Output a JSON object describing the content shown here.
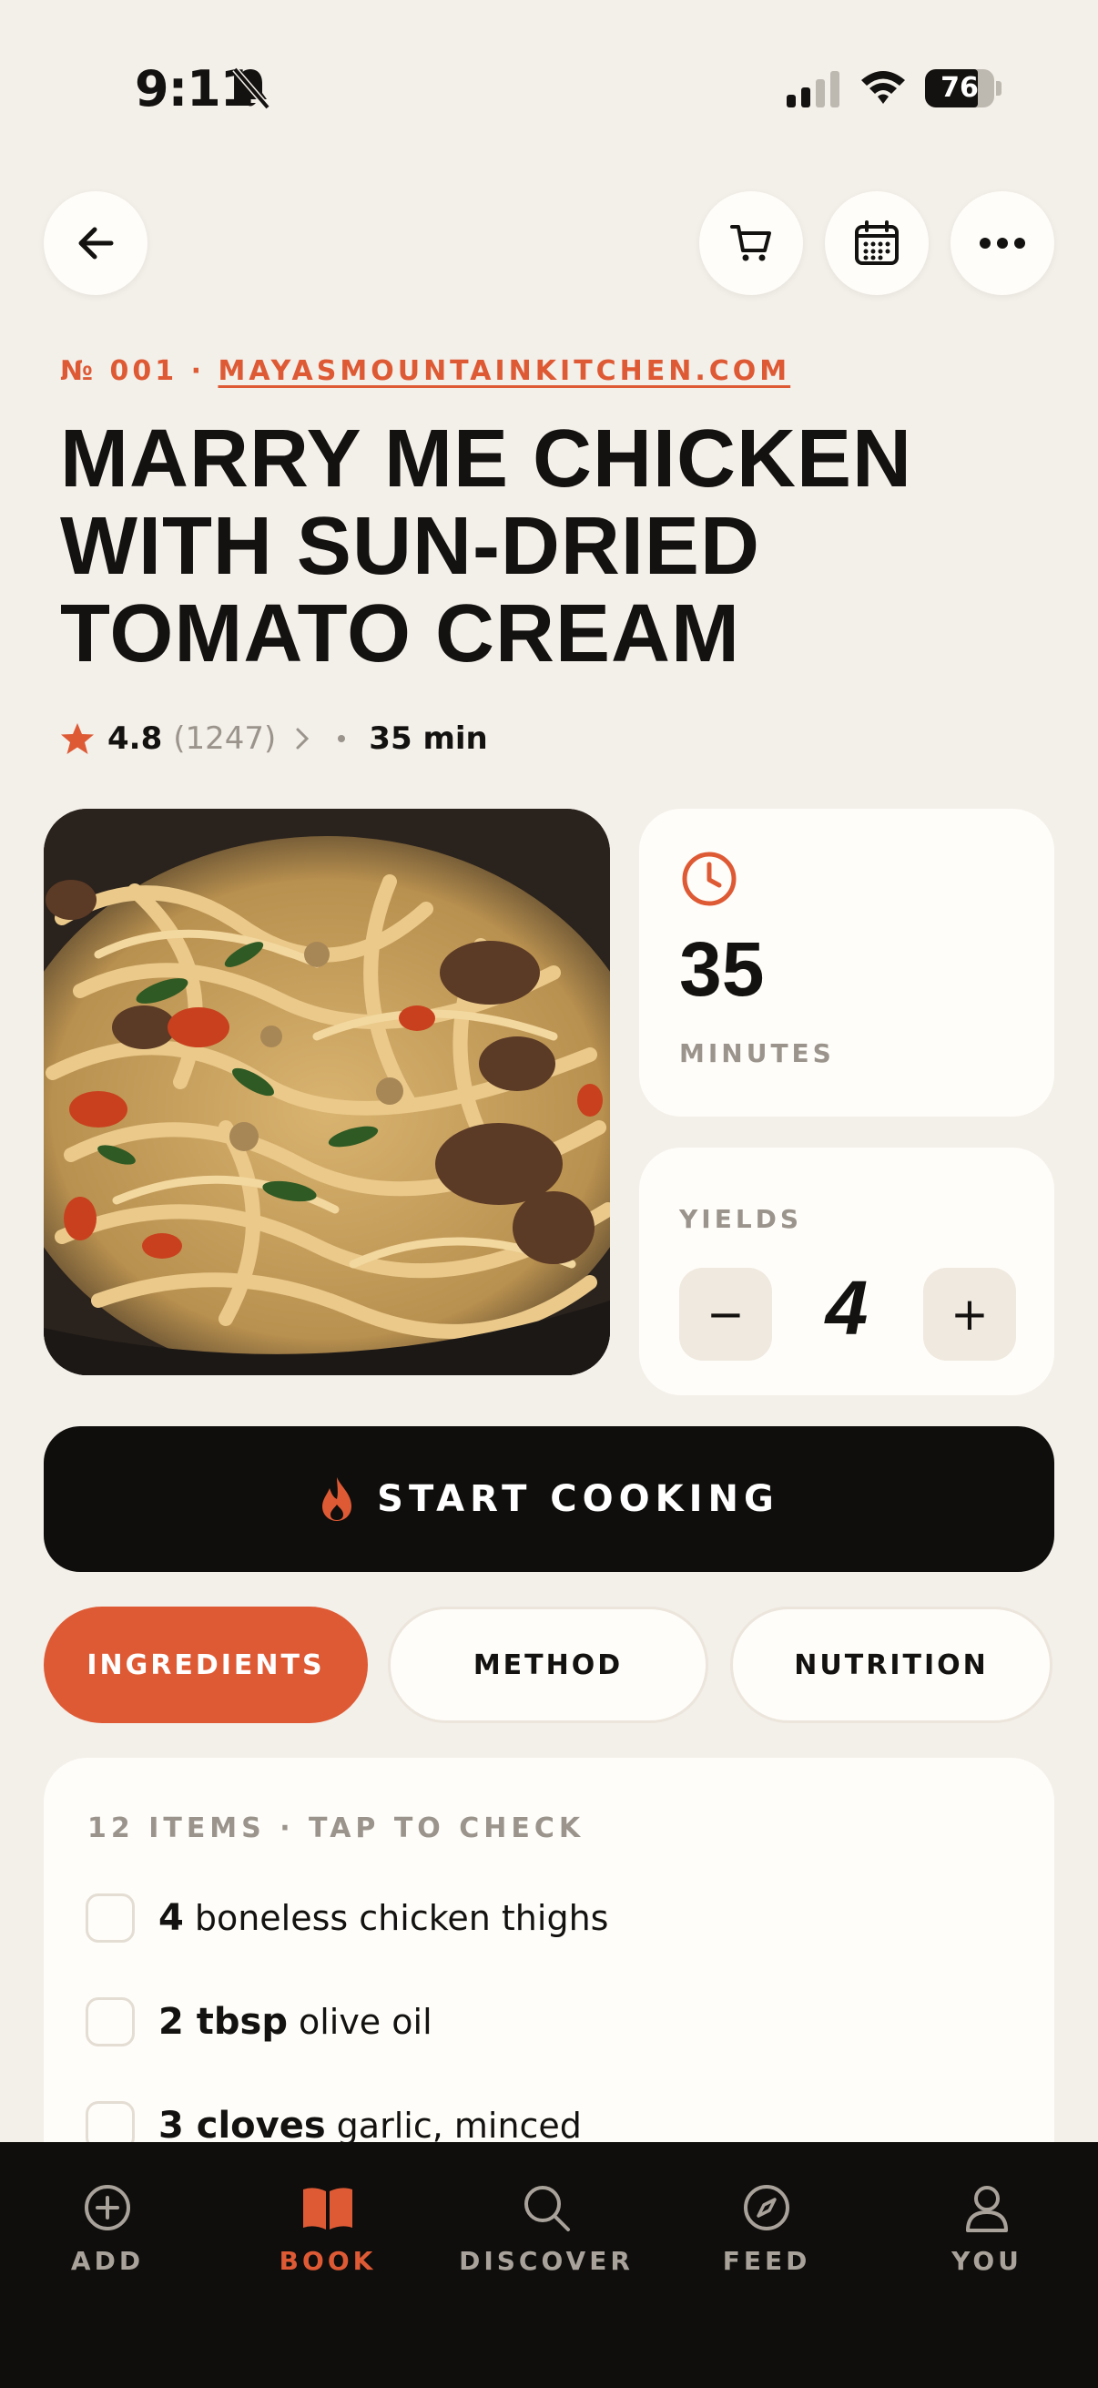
{
  "status_bar": {
    "time": "9:11",
    "battery": "76"
  },
  "recipe": {
    "number": "№ 001 ·",
    "source": "MAYASMOUNTAINKITCHEN.COM",
    "title": "MARRY ME CHICKEN WITH SUN-DRIED TOMATO CREAM",
    "rating": "4.8",
    "review_count": "(1247)",
    "total_time": "35 min"
  },
  "time_card": {
    "value": "35",
    "unit": "MINUTES"
  },
  "yield_card": {
    "label": "YIELDS",
    "value": "4",
    "minus": "−",
    "plus": "+"
  },
  "start_button": {
    "label": "START COOKING"
  },
  "tabs": [
    {
      "label": "INGREDIENTS",
      "active": true
    },
    {
      "label": "METHOD",
      "active": false
    },
    {
      "label": "NUTRITION",
      "active": false
    }
  ],
  "ingredients": {
    "header": "12 ITEMS · TAP TO CHECK",
    "items": [
      {
        "qty": "4",
        "name": "boneless chicken thighs"
      },
      {
        "qty": "2 tbsp",
        "name": "olive oil"
      },
      {
        "qty": "3 cloves",
        "name": "garlic, minced"
      }
    ]
  },
  "bottom_nav": [
    {
      "label": "ADD",
      "icon": "plus-circle-icon",
      "active": false
    },
    {
      "label": "BOOK",
      "icon": "book-icon",
      "active": true
    },
    {
      "label": "DISCOVER",
      "icon": "search-icon",
      "active": false
    },
    {
      "label": "FEED",
      "icon": "compass-icon",
      "active": false
    },
    {
      "label": "YOU",
      "icon": "user-icon",
      "active": false
    }
  ],
  "colors": {
    "accent": "#de5a35",
    "background": "#f3efe9",
    "card": "#fffdf9",
    "dark": "#0f0e0c"
  }
}
